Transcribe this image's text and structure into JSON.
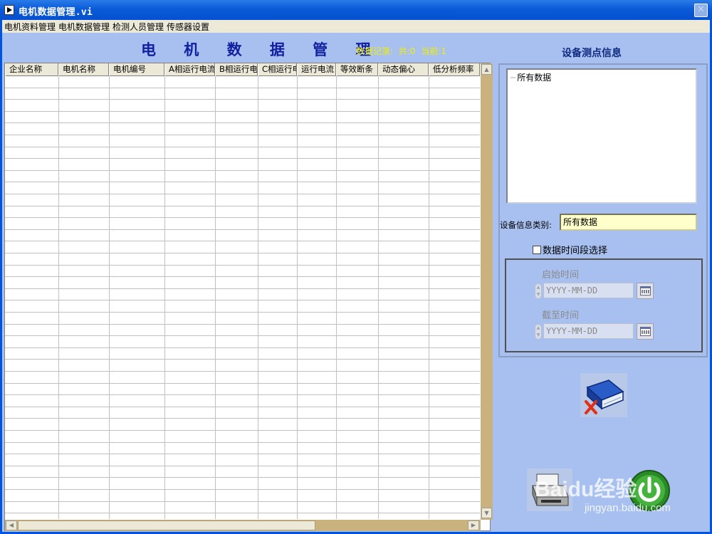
{
  "window": {
    "title": "电机数据管理.vi",
    "close_glyph": "✕"
  },
  "menu": [
    {
      "label": "电机资料管理"
    },
    {
      "label": "电机数据管理"
    },
    {
      "label": "检测人员管理"
    },
    {
      "label": "传感器设置"
    }
  ],
  "main": {
    "title": "电 机 数 据 管 理",
    "records": {
      "label": "数据记录:",
      "total": "共:0",
      "current": "当前:1"
    }
  },
  "table": {
    "columns": [
      "企业名称",
      "电机名称",
      "电机编号",
      "A相运行电流",
      "B相运行电",
      "C相运行电",
      "运行电流",
      "等效断条",
      "动态偏心",
      "低分析频率"
    ],
    "row_count": 37
  },
  "side": {
    "title": "设备测点信息",
    "tree_root": "所有数据",
    "category_label": "设备信息类别:",
    "category_value": "所有数据",
    "time_range_checkbox_label": "数据时间段选择",
    "time_range_checked": false,
    "start_label": "启始时间",
    "start_placeholder": "YYYY-MM-DD",
    "end_label": "截至时间",
    "end_placeholder": "YYYY-MM-DD"
  },
  "buttons": {
    "delete_icon": "book-delete-icon",
    "print_icon": "printer-icon",
    "exit_icon": "power-exit-icon"
  },
  "watermark": {
    "brand": "Baidu经验",
    "url": "jingyan.baidu.com"
  }
}
